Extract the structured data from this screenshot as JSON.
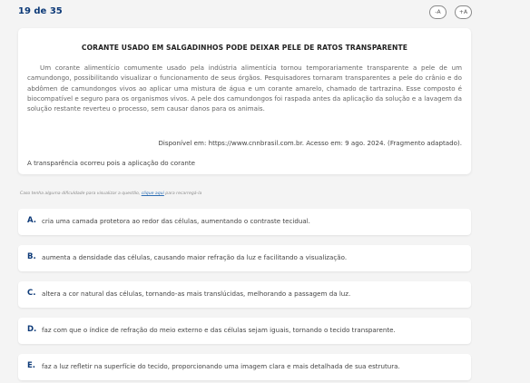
{
  "header": {
    "question_counter": "19 de 35",
    "decrease_font_label": "-A",
    "increase_font_label": "+A"
  },
  "question": {
    "title": "CORANTE USADO EM SALGADINHOS PODE DEIXAR PELE DE RATOS TRANSPARENTE",
    "body": "Um corante alimentício comumente usado pela indústria alimentícia tornou temporariamente transparente a pele de um camundongo, possibilitando visualizar o funcionamento de seus órgãos. Pesquisadores tornaram transparentes a pele do crânio e do abdômen de camundongos vivos ao aplicar uma mistura de água e um corante amarelo, chamado de tartrazina. Esse composto é biocompatível e seguro para os organismos vivos. A pele dos camundongos foi raspada antes da aplicação da solução e a lavagem da solução restante reverteu o processo, sem causar danos para os animais.",
    "source": "Disponível em: https://www.cnnbrasil.com.br. Acesso em: 9 ago. 2024. (Fragmento adaptado).",
    "prompt": "A transparência ocorreu pois a aplicação do corante"
  },
  "help": {
    "text_before": "Caso tenha alguma dificuldade para visualizar a questão, ",
    "link": "clique aqui",
    "text_after": " para recarregá-la"
  },
  "options": [
    {
      "letter": "A.",
      "text": "cria uma camada protetora ao redor das células, aumentando o contraste tecidual."
    },
    {
      "letter": "B.",
      "text": "aumenta a densidade das células, causando maior refração da luz e facilitando a visualização."
    },
    {
      "letter": "C.",
      "text": "altera a cor natural das células, tornando-as mais translúcidas, melhorando a passagem da luz."
    },
    {
      "letter": "D.",
      "text": "faz com que o índice de refração do meio externo e das células sejam iguais, tornando o tecido transparente."
    },
    {
      "letter": "E.",
      "text": "faz a luz refletir na superfície do tecido, proporcionando uma imagem clara e mais detalhada de sua estrutura."
    }
  ]
}
